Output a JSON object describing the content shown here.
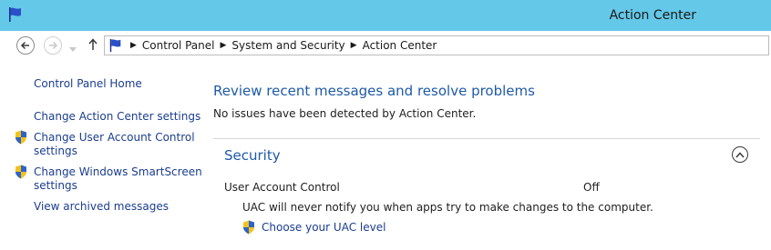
{
  "window": {
    "title": "Action Center"
  },
  "address": {
    "breadcrumbs": [
      "Control Panel",
      "System and Security",
      "Action Center"
    ]
  },
  "sidebar": {
    "home": "Control Panel Home",
    "links": [
      {
        "label": "Change Action Center settings"
      },
      {
        "label_line1": "Change User Account Control",
        "label_line2": "settings",
        "shield": true
      },
      {
        "label_line1": "Change Windows SmartScreen",
        "label_line2": "settings",
        "shield": true
      },
      {
        "label": "View archived messages"
      }
    ]
  },
  "main": {
    "title": "Review recent messages and resolve problems",
    "status": "No issues have been detected by Action Center.",
    "security": {
      "heading": "Security",
      "uac": {
        "label": "User Account Control",
        "value": "Off",
        "description": "UAC will never notify you when apps try to make changes to the computer.",
        "link": "Choose your UAC level"
      }
    }
  },
  "colors": {
    "titlebar": "#64c8e8",
    "link": "#1a3d8f",
    "heading": "#1e5aa8"
  }
}
